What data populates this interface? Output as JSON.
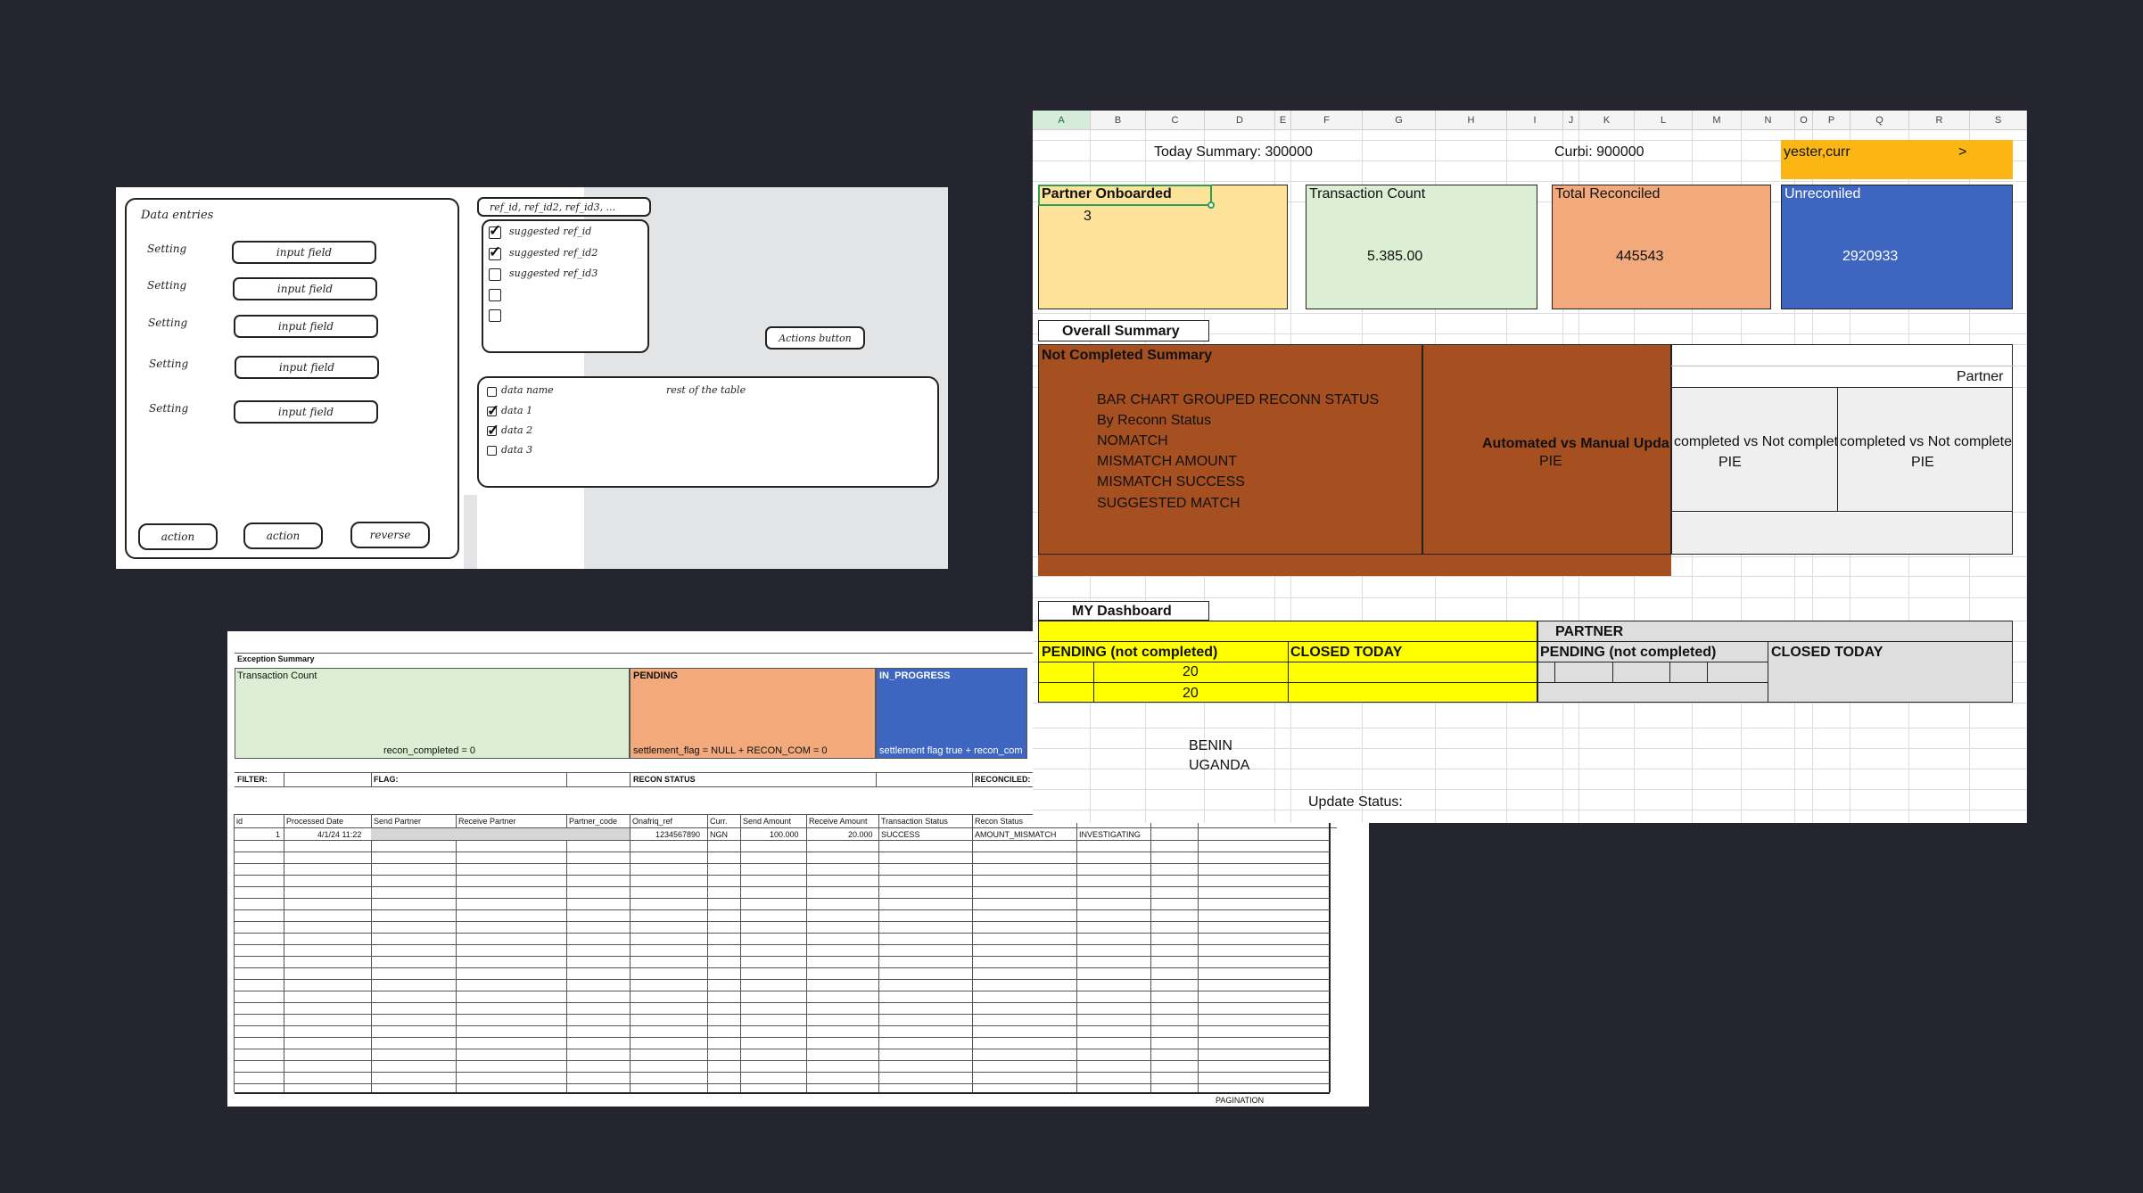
{
  "wireframe": {
    "title": "Data entries",
    "settings": [
      {
        "label": "Setting",
        "field": "input field"
      },
      {
        "label": "Setting",
        "field": "input field"
      },
      {
        "label": "Setting",
        "field": "input field"
      },
      {
        "label": "Setting",
        "field": "input field"
      },
      {
        "label": "Setting",
        "field": "input field"
      }
    ],
    "footer_buttons": [
      "action",
      "action",
      "reverse"
    ],
    "ref_header": "ref_id, ref_id2, ref_id3, ...",
    "suggestions": [
      {
        "label": "suggested ref_id",
        "checked": true
      },
      {
        "label": "suggested ref_id2",
        "checked": true
      },
      {
        "label": "suggested ref_id3",
        "checked": false
      },
      {
        "label": "",
        "checked": false
      },
      {
        "label": "",
        "checked": false
      }
    ],
    "actions_button": "Actions button",
    "table": {
      "header": "data name",
      "rest": "rest of the table",
      "rows": [
        {
          "label": "data 1",
          "checked": true
        },
        {
          "label": "data 2",
          "checked": true
        },
        {
          "label": "data 3",
          "checked": false
        }
      ]
    }
  },
  "exception": {
    "title": "Exception Summary",
    "card_count_label": "Transaction Count",
    "card_count_note": "recon_completed = 0",
    "card_pending_label": "PENDING",
    "card_pending_note": "settlement_flag = NULL + RECON_COM = 0",
    "card_progress_label": "IN_PROGRESS",
    "card_progress_note": "settlement flag true + recon_com",
    "filter_label": "FILTER:",
    "flag_label": "FLAG:",
    "recon_status_label": "RECON STATUS",
    "reconciled_label": "RECONCILED:",
    "columns": [
      "id",
      "Processed Date",
      "Send Partner",
      "Receive Partner",
      "Partner_code",
      "Onafriq_ref",
      "Curr.",
      "Send Amount",
      "Receive Amount",
      "Transaction Status",
      "Recon Status"
    ],
    "row": [
      "1",
      "4/1/24 11:22",
      "",
      "",
      "",
      "1234567890",
      "NGN",
      "100.000",
      "20.000",
      "SUCCESS",
      "AMOUNT_MISMATCH",
      "INVESTIGATING"
    ],
    "pagination": "PAGINATION"
  },
  "dashboard": {
    "columns": [
      "A",
      "B",
      "C",
      "D",
      "E",
      "F",
      "G",
      "H",
      "I",
      "J",
      "K",
      "L",
      "M",
      "N",
      "O",
      "P",
      "Q",
      "R",
      "S"
    ],
    "today_summary": "Today Summary:  300000",
    "curbi": "Curbi: 900000",
    "yester": "yester,curr",
    "yester_arrow": ">",
    "cards": {
      "partner_label": "Partner Onboarded",
      "partner_value": "3",
      "tx_label": "Transaction Count",
      "tx_value": "5.385.00",
      "reconciled_label": "Total Reconciled",
      "reconciled_value": "445543",
      "unreconciled_label": "Unreconiled",
      "unreconciled_value": "2920933"
    },
    "overall_summary": "Overall Summary",
    "not_completed": "Not Completed Summary",
    "bar_chart_lines": [
      "BAR CHART GROUPED RECONN STATUS",
      "By Reconn Status",
      "NOMATCH",
      "MISMATCH AMOUNT",
      "MISMATCH SUCCESS",
      "SUGGESTED MATCH"
    ],
    "automated_label": "Automated vs Manual Upda",
    "automated_pie": "PIE",
    "partner_label": "Partner",
    "completed_1": "completed vs Not complete",
    "completed_1_pie": "PIE",
    "completed_2": "completed vs Not completed",
    "completed_2_pie": "PIE",
    "my_dashboard": "MY Dashboard",
    "partner_header": "PARTNER",
    "pending_1": "PENDING (not completed)",
    "closed_1": "CLOSED TODAY",
    "pending_2": "PENDING (not completed)",
    "closed_2": "CLOSED TODAY",
    "val_1": "20",
    "val_2": "20",
    "benin": "BENIN",
    "uganda": "UGANDA",
    "update_status": "Update Status:",
    "colors": {
      "light_yellow": "#fde39a",
      "light_green": "#dceed4",
      "salmon": "#f2a97b",
      "blue": "#3e66c0",
      "brown": "#a64f20",
      "gold": "#fbb614",
      "yellow": "#ffff00"
    }
  }
}
